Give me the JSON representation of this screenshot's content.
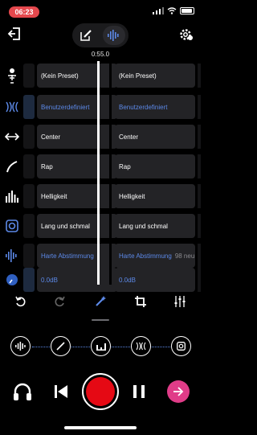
{
  "status_bar": {
    "time": "06:23"
  },
  "timecode": "0:55.0",
  "rows": [
    {
      "icon": "figure-voice-icon",
      "left_value": "(Kein Preset)",
      "right_value": "(Kein Preset)",
      "right_sub": "",
      "highlight": false
    },
    {
      "icon": "reverb-waves-icon",
      "left_value": "Benutzerdefiniert",
      "right_value": "Benutzerdefiniert",
      "right_sub": "",
      "highlight": true
    },
    {
      "icon": "stereo-arrows-icon",
      "left_value": "Center",
      "right_value": "Center",
      "right_sub": "",
      "highlight": false
    },
    {
      "icon": "curve-icon",
      "left_value": "Rap",
      "right_value": "Rap",
      "right_sub": "",
      "highlight": false
    },
    {
      "icon": "equalizer-bars-icon",
      "left_value": "Helligkeit",
      "right_value": "Helligkeit",
      "right_sub": "",
      "highlight": false
    },
    {
      "icon": "speaker-box-icon",
      "left_value": "Lang und schmal",
      "right_value": "Lang und schmal",
      "right_sub": "",
      "highlight": false
    },
    {
      "icon": "pitch-wave-icon",
      "left_value": "Harte Abstimmung",
      "right_value": "Harte Abstimmung",
      "right_sub": "98 neu...",
      "highlight": false
    },
    {
      "icon": "gain-dial-icon",
      "left_value": "0.0dB",
      "right_value": "0.0dB",
      "right_sub": "",
      "highlight": false
    }
  ],
  "colors": {
    "accent_blue": "#5c89e8",
    "record_red": "#e50914",
    "next_pink": "#e03c88",
    "status_red": "#e5484d"
  }
}
